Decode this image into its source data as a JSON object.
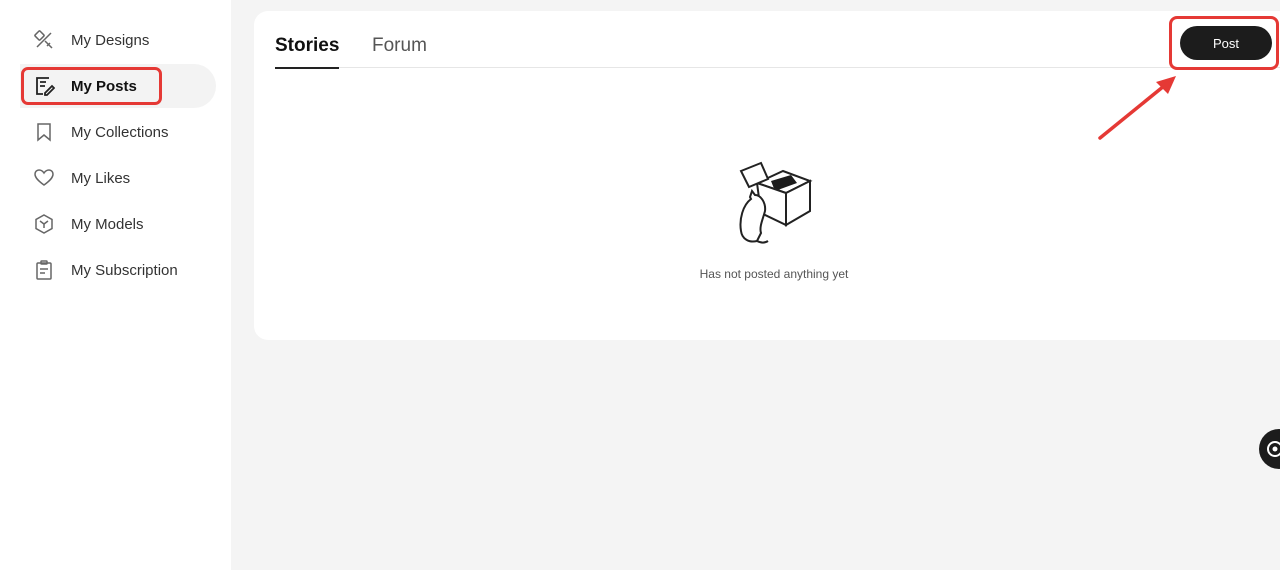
{
  "sidebar": {
    "items": [
      {
        "label": "My Designs",
        "icon": "designs-icon",
        "active": false
      },
      {
        "label": "My Posts",
        "icon": "edit-post-icon",
        "active": true
      },
      {
        "label": "My Collections",
        "icon": "bookmark-icon",
        "active": false
      },
      {
        "label": "My Likes",
        "icon": "heart-icon",
        "active": false
      },
      {
        "label": "My Models",
        "icon": "cube-icon",
        "active": false
      },
      {
        "label": "My Subscription",
        "icon": "clipboard-icon",
        "active": false
      }
    ]
  },
  "main": {
    "tabs": [
      {
        "label": "Stories",
        "active": true
      },
      {
        "label": "Forum",
        "active": false
      }
    ],
    "post_button": "Post",
    "empty_message": "Has not posted anything yet"
  },
  "colors": {
    "highlight": "#e53935",
    "button_bg": "#1c1c1c",
    "page_bg": "#f4f4f4"
  }
}
